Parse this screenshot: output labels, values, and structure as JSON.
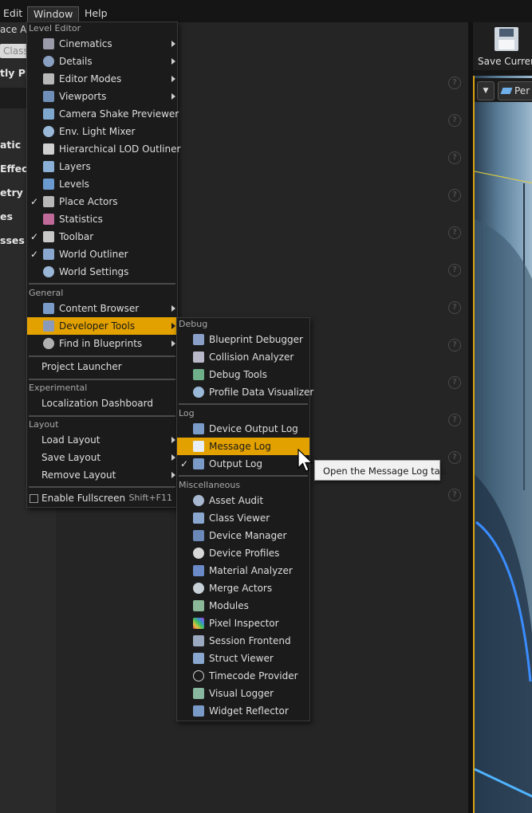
{
  "menubar": {
    "edit": "Edit",
    "window": "Window",
    "help": "Help"
  },
  "left_panel": {
    "place_actors_title": "ace Ac",
    "search_placeholder": "Class",
    "recently_placed": "tly Pla",
    "categories": [
      "atic",
      "Effect",
      "etry",
      "es",
      "sses"
    ]
  },
  "toolbar": {
    "save_label": "Save Current"
  },
  "viewport": {
    "dropdown_glyph": "▼",
    "perspective_label": "Per"
  },
  "window_menu": {
    "sections": {
      "level_editor": "Level Editor",
      "general": "General",
      "experimental": "Experimental",
      "layout": "Layout"
    },
    "items": {
      "cinematics": "Cinematics",
      "details": "Details",
      "editor_modes": "Editor Modes",
      "viewports": "Viewports",
      "camera_shake": "Camera Shake Previewer",
      "env_light_mixer": "Env. Light Mixer",
      "hlod_outliner": "Hierarchical LOD Outliner",
      "layers": "Layers",
      "levels": "Levels",
      "place_actors": "Place Actors",
      "statistics": "Statistics",
      "toolbar": "Toolbar",
      "world_outliner": "World Outliner",
      "world_settings": "World Settings",
      "content_browser": "Content Browser",
      "developer_tools": "Developer Tools",
      "find_in_blueprints": "Find in Blueprints",
      "project_launcher": "Project Launcher",
      "localization_dashboard": "Localization Dashboard",
      "load_layout": "Load Layout",
      "save_layout": "Save Layout",
      "remove_layout": "Remove Layout",
      "enable_fullscreen": "Enable Fullscreen",
      "fullscreen_shortcut": "Shift+F11"
    },
    "check_glyph": "✓"
  },
  "dev_tools_menu": {
    "sections": {
      "debug": "Debug",
      "log": "Log",
      "misc": "Miscellaneous"
    },
    "items": {
      "blueprint_debugger": "Blueprint Debugger",
      "collision_analyzer": "Collision Analyzer",
      "debug_tools": "Debug Tools",
      "profile_data_visualizer": "Profile Data Visualizer",
      "device_output_log": "Device Output Log",
      "message_log": "Message Log",
      "output_log": "Output Log",
      "asset_audit": "Asset Audit",
      "class_viewer": "Class Viewer",
      "device_manager": "Device Manager",
      "device_profiles": "Device Profiles",
      "material_analyzer": "Material Analyzer",
      "merge_actors": "Merge Actors",
      "modules": "Modules",
      "pixel_inspector": "Pixel Inspector",
      "session_frontend": "Session Frontend",
      "struct_viewer": "Struct Viewer",
      "timecode_provider": "Timecode Provider",
      "visual_logger": "Visual Logger",
      "widget_reflector": "Widget Reflector"
    }
  },
  "tooltip": {
    "text": "Open the Message Log tab."
  },
  "help_glyph": "?",
  "colors": {
    "highlight": "#e3a100",
    "menu_bg": "#1b1b1b",
    "panel_bg": "#252525"
  }
}
